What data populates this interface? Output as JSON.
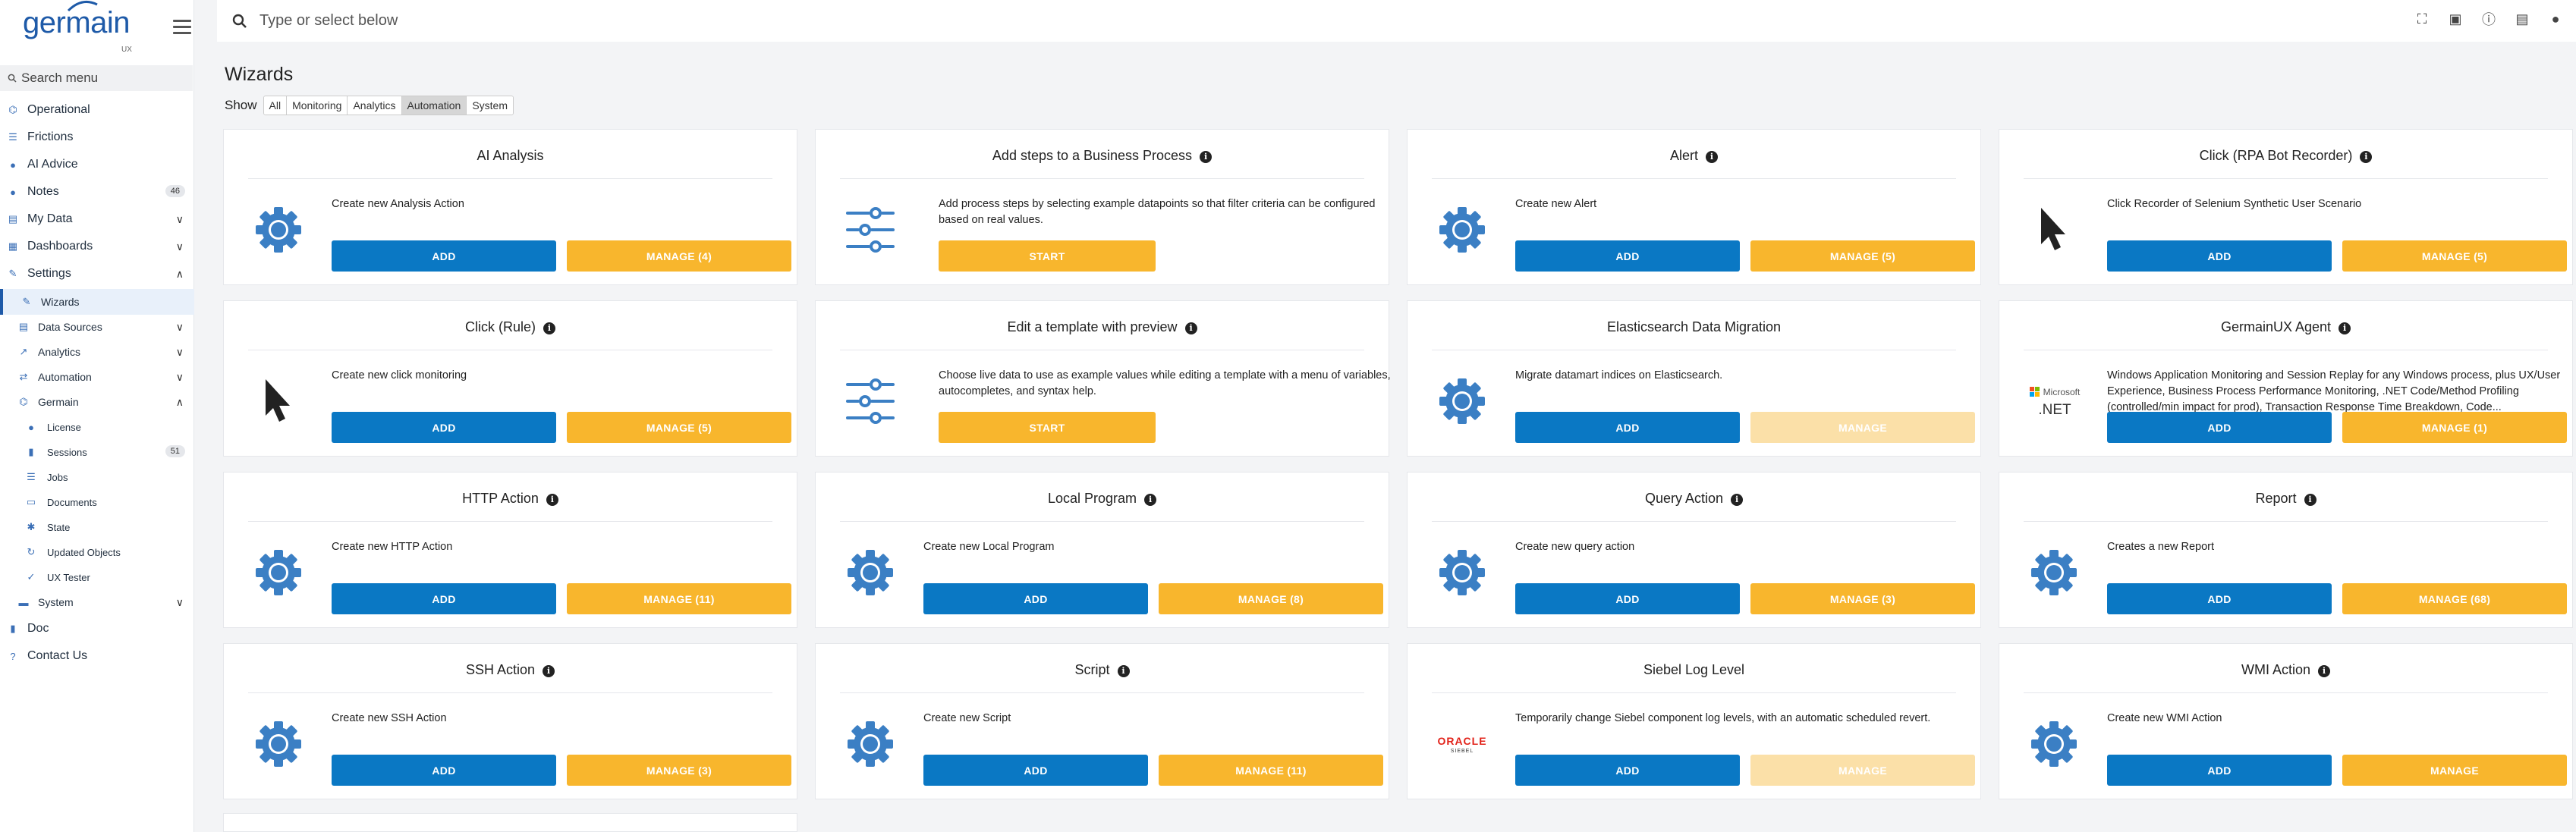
{
  "app": {
    "logo_text": "germain",
    "logo_sub": "UX"
  },
  "sidebar": {
    "search_placeholder": "Search menu",
    "items": [
      {
        "label": "Operational"
      },
      {
        "label": "Frictions"
      },
      {
        "label": "AI Advice"
      },
      {
        "label": "Notes",
        "badge": "46"
      },
      {
        "label": "My Data"
      },
      {
        "label": "Dashboards"
      },
      {
        "label": "Settings"
      },
      {
        "label": "Wizards"
      },
      {
        "label": "Data Sources"
      },
      {
        "label": "Analytics"
      },
      {
        "label": "Automation"
      },
      {
        "label": "Germain"
      },
      {
        "label": "License"
      },
      {
        "label": "Sessions",
        "badge": "51"
      },
      {
        "label": "Jobs"
      },
      {
        "label": "Documents"
      },
      {
        "label": "State"
      },
      {
        "label": "Updated Objects"
      },
      {
        "label": "UX Tester"
      },
      {
        "label": "System"
      },
      {
        "label": "Doc"
      },
      {
        "label": "Contact Us"
      }
    ]
  },
  "topbar": {
    "search_placeholder": "Type or select below"
  },
  "page": {
    "title": "Wizards",
    "filter_label": "Show",
    "filters": [
      "All",
      "Monitoring",
      "Analytics",
      "Automation",
      "System"
    ],
    "selected_filter": "Automation"
  },
  "cards": [
    {
      "title": "AI Analysis",
      "desc": "Create new Analysis Action",
      "add": "ADD",
      "manage": "MANAGE (4)"
    },
    {
      "title": "Add steps to a Business Process",
      "desc": "Add process steps by selecting example datapoints so that filter criteria can be configured based on real values.",
      "start": "START"
    },
    {
      "title": "Alert",
      "desc": "Create new Alert",
      "add": "ADD",
      "manage": "MANAGE (5)"
    },
    {
      "title": "Click (RPA Bot Recorder)",
      "desc": "Click Recorder of Selenium Synthetic User Scenario",
      "add": "ADD",
      "manage": "MANAGE (5)"
    },
    {
      "title": "Click (Rule)",
      "desc": "Create new click monitoring",
      "add": "ADD",
      "manage": "MANAGE (5)"
    },
    {
      "title": "Edit a template with preview",
      "desc": "Choose live data to use as example values while editing a template with a menu of variables, autocompletes, and syntax help.",
      "start": "START"
    },
    {
      "title": "Elasticsearch Data Migration",
      "desc": "Migrate datamart indices on Elasticsearch.",
      "add": "ADD",
      "manage": "MANAGE"
    },
    {
      "title": "GermainUX Agent",
      "desc": "Windows Application Monitoring and Session Replay for any Windows process, plus UX/User Experience, Business Process Performance Monitoring, .NET Code/Method Profiling (controlled/min impact for prod), Transaction Response Time Breakdown, Code...",
      "add": "ADD",
      "manage": "MANAGE (1)",
      "logo_top": "Microsoft",
      "logo_bottom": ".NET"
    },
    {
      "title": "HTTP Action",
      "desc": "Create new HTTP Action",
      "add": "ADD",
      "manage": "MANAGE (11)"
    },
    {
      "title": "Local Program",
      "desc": "Create new Local Program",
      "add": "ADD",
      "manage": "MANAGE (8)"
    },
    {
      "title": "Query Action",
      "desc": "Create new query action",
      "add": "ADD",
      "manage": "MANAGE (3)"
    },
    {
      "title": "Report",
      "desc": "Creates a new Report",
      "add": "ADD",
      "manage": "MANAGE (68)"
    },
    {
      "title": "SSH Action",
      "desc": "Create new SSH Action",
      "add": "ADD",
      "manage": "MANAGE (3)"
    },
    {
      "title": "Script",
      "desc": "Create new Script",
      "add": "ADD",
      "manage": "MANAGE (11)"
    },
    {
      "title": "Siebel Log Level",
      "desc": "Temporarily change Siebel component log levels, with an automatic scheduled revert.",
      "add": "ADD",
      "manage": "MANAGE",
      "logo_top": "ORACLE",
      "logo_bottom": "SIEBEL"
    },
    {
      "title": "WMI Action",
      "desc": "Create new WMI Action",
      "add": "ADD",
      "manage": "MANAGE"
    }
  ],
  "colors": {
    "primary": "#0a78c4",
    "accent": "#f8b62d",
    "icon_blue": "#3b7fc4"
  }
}
